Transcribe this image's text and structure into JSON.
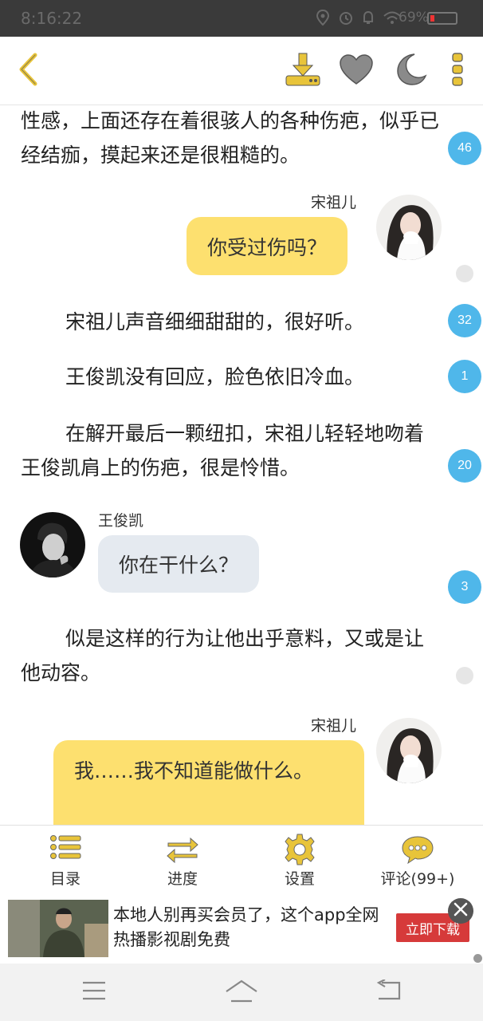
{
  "status_bar": {
    "time": "8:16:22",
    "battery": "69%",
    "icons": [
      "location-icon",
      "alarm-icon",
      "wifi-icon",
      "battery-icon"
    ]
  },
  "toolbar": {
    "icons": [
      "back-icon",
      "download-icon",
      "heart-icon",
      "moon-icon",
      "more-icon"
    ]
  },
  "content": {
    "paragraphs": [
      {
        "text": "性感，上面还存在着很骇人的各种伤疤，似乎已经结痂，摸起来还是很粗糙的。",
        "comments": "46"
      },
      {
        "text": "宋祖儿声音细细甜甜的，很好听。",
        "comments": "32"
      },
      {
        "text": "王俊凯没有回应，脸色依旧冷血。",
        "comments": "1"
      },
      {
        "text": "在解开最后一颗纽扣，宋祖儿轻轻地吻着王俊凯肩上的伤疤，很是怜惜。",
        "comments": "20"
      },
      {
        "text": "似是这样的行为让他出乎意料，又或是让他动容。",
        "comments": ""
      }
    ],
    "messages": [
      {
        "speaker": "宋祖儿",
        "text": "你受过伤吗？",
        "comments": ""
      },
      {
        "speaker": "王俊凯",
        "text": "你在干什么？",
        "comments": "3"
      },
      {
        "speaker": "宋祖儿",
        "text": "我……我不知道能做什么。",
        "comments": ""
      }
    ]
  },
  "bottom_nav": [
    {
      "label": "目录",
      "icon": "list-icon"
    },
    {
      "label": "进度",
      "icon": "progress-arrows-icon"
    },
    {
      "label": "设置",
      "icon": "gear-icon"
    },
    {
      "label": "评论(99+)",
      "icon": "chat-bubble-icon"
    }
  ],
  "ad": {
    "text": "本地人别再买会员了，这个app全网热播影视剧免费",
    "button": "立即下载"
  },
  "colors": {
    "accent": "#fde06f",
    "icon_yellow": "#e8c43a",
    "badge_blue": "#4fb7ea",
    "bubble_gray": "#e5eaf0",
    "ad_red": "#d63a3a"
  }
}
